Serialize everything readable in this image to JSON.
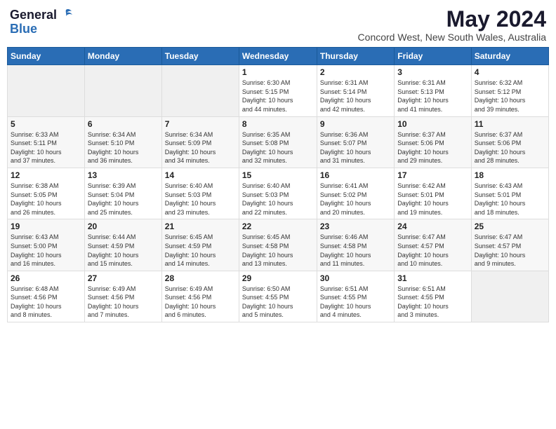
{
  "header": {
    "logo": {
      "general": "General",
      "blue": "Blue"
    },
    "title": "May 2024",
    "subtitle": "Concord West, New South Wales, Australia"
  },
  "calendar": {
    "days_of_week": [
      "Sunday",
      "Monday",
      "Tuesday",
      "Wednesday",
      "Thursday",
      "Friday",
      "Saturday"
    ],
    "weeks": [
      [
        {
          "day": "",
          "info": ""
        },
        {
          "day": "",
          "info": ""
        },
        {
          "day": "",
          "info": ""
        },
        {
          "day": "1",
          "info": "Sunrise: 6:30 AM\nSunset: 5:15 PM\nDaylight: 10 hours\nand 44 minutes."
        },
        {
          "day": "2",
          "info": "Sunrise: 6:31 AM\nSunset: 5:14 PM\nDaylight: 10 hours\nand 42 minutes."
        },
        {
          "day": "3",
          "info": "Sunrise: 6:31 AM\nSunset: 5:13 PM\nDaylight: 10 hours\nand 41 minutes."
        },
        {
          "day": "4",
          "info": "Sunrise: 6:32 AM\nSunset: 5:12 PM\nDaylight: 10 hours\nand 39 minutes."
        }
      ],
      [
        {
          "day": "5",
          "info": "Sunrise: 6:33 AM\nSunset: 5:11 PM\nDaylight: 10 hours\nand 37 minutes."
        },
        {
          "day": "6",
          "info": "Sunrise: 6:34 AM\nSunset: 5:10 PM\nDaylight: 10 hours\nand 36 minutes."
        },
        {
          "day": "7",
          "info": "Sunrise: 6:34 AM\nSunset: 5:09 PM\nDaylight: 10 hours\nand 34 minutes."
        },
        {
          "day": "8",
          "info": "Sunrise: 6:35 AM\nSunset: 5:08 PM\nDaylight: 10 hours\nand 32 minutes."
        },
        {
          "day": "9",
          "info": "Sunrise: 6:36 AM\nSunset: 5:07 PM\nDaylight: 10 hours\nand 31 minutes."
        },
        {
          "day": "10",
          "info": "Sunrise: 6:37 AM\nSunset: 5:06 PM\nDaylight: 10 hours\nand 29 minutes."
        },
        {
          "day": "11",
          "info": "Sunrise: 6:37 AM\nSunset: 5:06 PM\nDaylight: 10 hours\nand 28 minutes."
        }
      ],
      [
        {
          "day": "12",
          "info": "Sunrise: 6:38 AM\nSunset: 5:05 PM\nDaylight: 10 hours\nand 26 minutes."
        },
        {
          "day": "13",
          "info": "Sunrise: 6:39 AM\nSunset: 5:04 PM\nDaylight: 10 hours\nand 25 minutes."
        },
        {
          "day": "14",
          "info": "Sunrise: 6:40 AM\nSunset: 5:03 PM\nDaylight: 10 hours\nand 23 minutes."
        },
        {
          "day": "15",
          "info": "Sunrise: 6:40 AM\nSunset: 5:03 PM\nDaylight: 10 hours\nand 22 minutes."
        },
        {
          "day": "16",
          "info": "Sunrise: 6:41 AM\nSunset: 5:02 PM\nDaylight: 10 hours\nand 20 minutes."
        },
        {
          "day": "17",
          "info": "Sunrise: 6:42 AM\nSunset: 5:01 PM\nDaylight: 10 hours\nand 19 minutes."
        },
        {
          "day": "18",
          "info": "Sunrise: 6:43 AM\nSunset: 5:01 PM\nDaylight: 10 hours\nand 18 minutes."
        }
      ],
      [
        {
          "day": "19",
          "info": "Sunrise: 6:43 AM\nSunset: 5:00 PM\nDaylight: 10 hours\nand 16 minutes."
        },
        {
          "day": "20",
          "info": "Sunrise: 6:44 AM\nSunset: 4:59 PM\nDaylight: 10 hours\nand 15 minutes."
        },
        {
          "day": "21",
          "info": "Sunrise: 6:45 AM\nSunset: 4:59 PM\nDaylight: 10 hours\nand 14 minutes."
        },
        {
          "day": "22",
          "info": "Sunrise: 6:45 AM\nSunset: 4:58 PM\nDaylight: 10 hours\nand 13 minutes."
        },
        {
          "day": "23",
          "info": "Sunrise: 6:46 AM\nSunset: 4:58 PM\nDaylight: 10 hours\nand 11 minutes."
        },
        {
          "day": "24",
          "info": "Sunrise: 6:47 AM\nSunset: 4:57 PM\nDaylight: 10 hours\nand 10 minutes."
        },
        {
          "day": "25",
          "info": "Sunrise: 6:47 AM\nSunset: 4:57 PM\nDaylight: 10 hours\nand 9 minutes."
        }
      ],
      [
        {
          "day": "26",
          "info": "Sunrise: 6:48 AM\nSunset: 4:56 PM\nDaylight: 10 hours\nand 8 minutes."
        },
        {
          "day": "27",
          "info": "Sunrise: 6:49 AM\nSunset: 4:56 PM\nDaylight: 10 hours\nand 7 minutes."
        },
        {
          "day": "28",
          "info": "Sunrise: 6:49 AM\nSunset: 4:56 PM\nDaylight: 10 hours\nand 6 minutes."
        },
        {
          "day": "29",
          "info": "Sunrise: 6:50 AM\nSunset: 4:55 PM\nDaylight: 10 hours\nand 5 minutes."
        },
        {
          "day": "30",
          "info": "Sunrise: 6:51 AM\nSunset: 4:55 PM\nDaylight: 10 hours\nand 4 minutes."
        },
        {
          "day": "31",
          "info": "Sunrise: 6:51 AM\nSunset: 4:55 PM\nDaylight: 10 hours\nand 3 minutes."
        },
        {
          "day": "",
          "info": ""
        }
      ]
    ]
  }
}
